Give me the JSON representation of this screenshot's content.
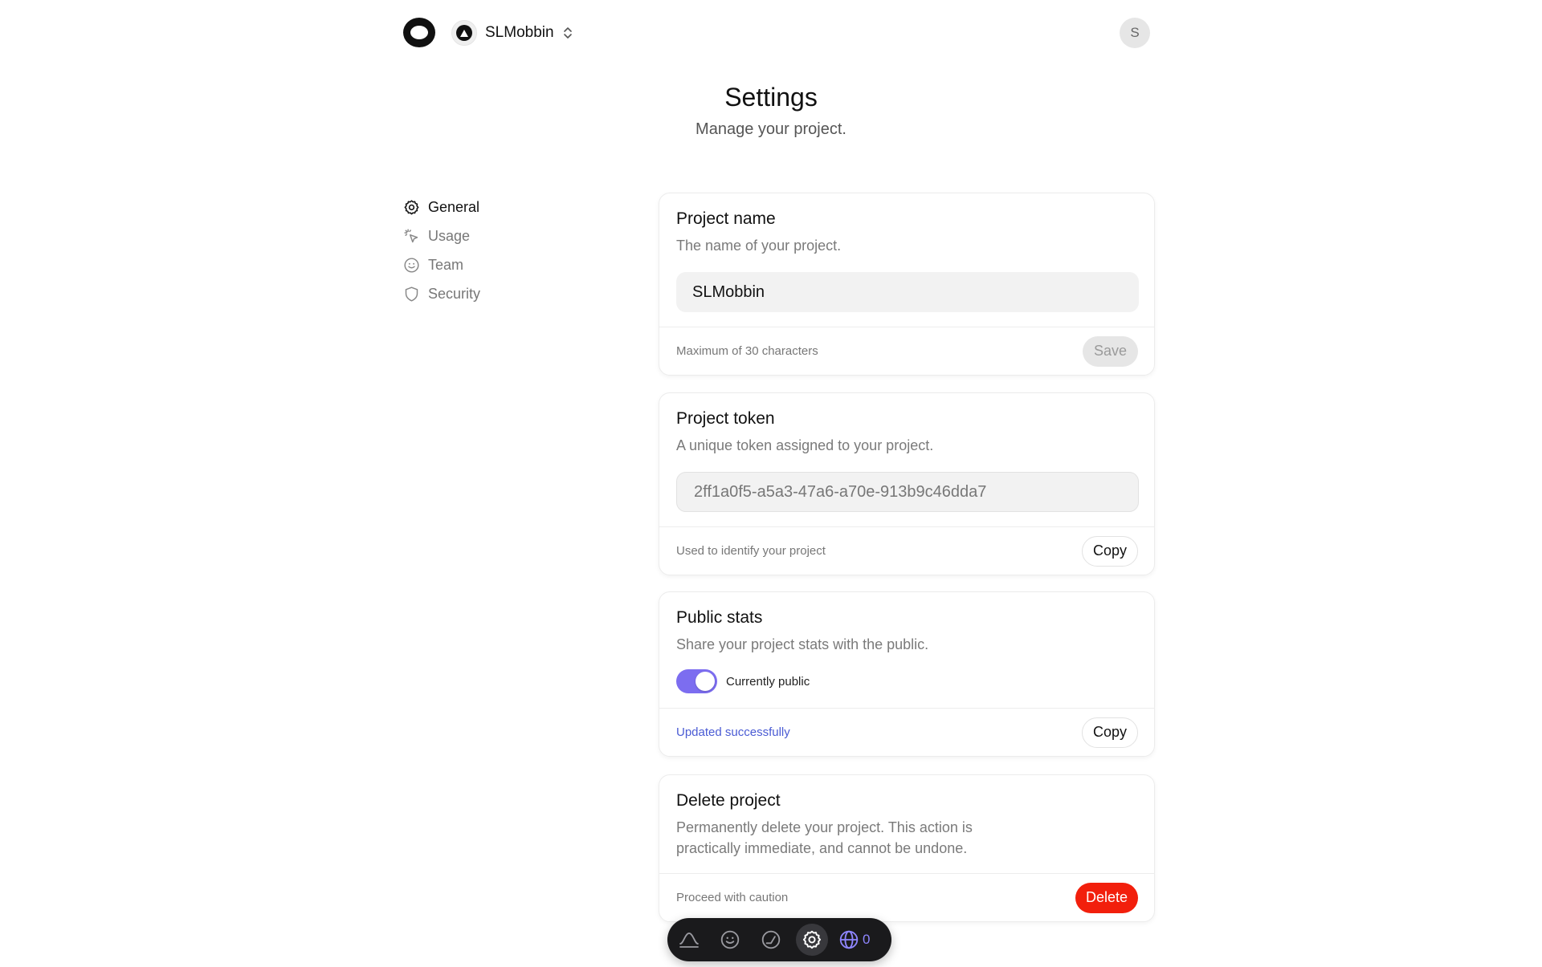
{
  "header": {
    "project_name": "SLMobbin",
    "user_initial": "S",
    "title": "Settings",
    "subtitle": "Manage your project."
  },
  "sidebar": {
    "items": [
      {
        "label": "General",
        "icon": "gear-icon",
        "active": true
      },
      {
        "label": "Usage",
        "icon": "cursor-click-icon",
        "active": false
      },
      {
        "label": "Team",
        "icon": "smiley-icon",
        "active": false
      },
      {
        "label": "Security",
        "icon": "shield-icon",
        "active": false
      }
    ]
  },
  "cards": {
    "project_name": {
      "title": "Project name",
      "description": "The name of your project.",
      "value": "SLMobbin",
      "footer": "Maximum of 30 characters",
      "button": "Save"
    },
    "project_token": {
      "title": "Project token",
      "description": "A unique token assigned to your project.",
      "value": "2ff1a0f5-a5a3-47a6-a70e-913b9c46dda7",
      "footer": "Used to identify your project",
      "button": "Copy"
    },
    "public_stats": {
      "title": "Public stats",
      "description": "Share your project stats with the public.",
      "toggle_label": "Currently public",
      "toggle_on": true,
      "footer": "Updated successfully",
      "button": "Copy"
    },
    "delete_project": {
      "title": "Delete project",
      "description_line1": "Permanently delete your project. This action is",
      "description_line2": "practically immediate, and cannot be undone.",
      "footer": "Proceed with caution",
      "button": "Delete"
    }
  },
  "dock": {
    "items": [
      "chart-curve-icon",
      "smiley-icon",
      "gauge-icon",
      "gear-icon",
      "globe-icon"
    ],
    "active": "gear-icon",
    "visitor_count": "0"
  },
  "colors": {
    "accent": "#7c6df0",
    "danger": "#f21f0c",
    "success_text": "#4a5bd4"
  }
}
